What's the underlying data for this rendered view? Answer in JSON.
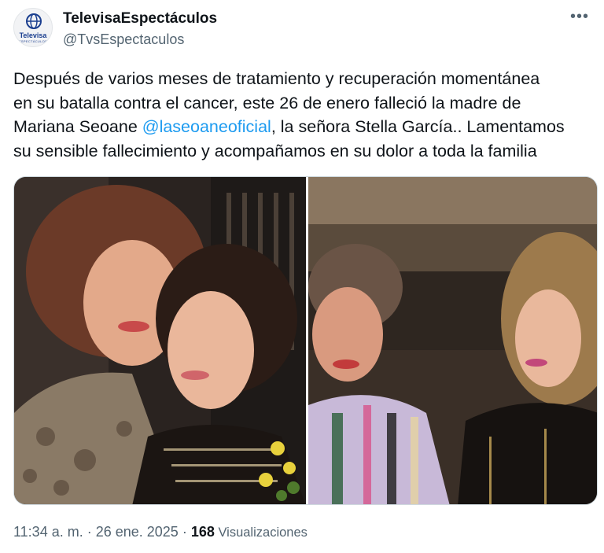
{
  "account": {
    "display_name": "TelevisaEspectáculos",
    "handle": "@TvsEspectaculos",
    "avatar_text": "Televisa",
    "avatar_subtext": "ESPECTÁCULOS"
  },
  "more_icon": "more-horizontal-icon",
  "tweet": {
    "line1": "Después de varios meses de tratamiento y recuperación momentánea",
    "line2": "en su batalla contra el cancer, este 26 de enero falleció la madre de",
    "line3_before": "Mariana Seoane ",
    "mention": "@laseoaneoficial",
    "line3_after": ", la señora Stella García.. Lamentamos",
    "line4": "su sensible fallecimiento y acompañamos en su dolor a toda la familia"
  },
  "meta": {
    "time": "11:34 a. m.",
    "sep1": " · ",
    "date": "26 ene. 2025",
    "sep2": " · ",
    "views_count": "168",
    "views_label": " Visualizaciones"
  },
  "colors": {
    "text": "#0f1419",
    "secondary": "#536471",
    "mention": "#1d9bf0",
    "border": "#cfd9de"
  }
}
